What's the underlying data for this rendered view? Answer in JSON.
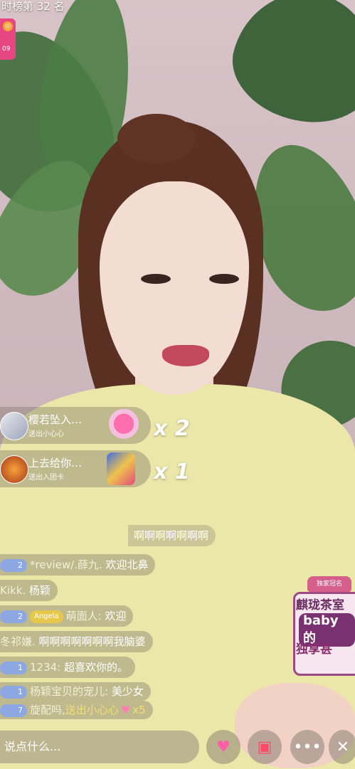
{
  "header": {
    "rank_text": "时榜第 32 名",
    "level_badge_number": "09"
  },
  "gift_banners": [
    {
      "name": "樱若坠入…",
      "sub": "送出小心心",
      "count": "x 2",
      "gift_icon": "heart-gift-icon"
    },
    {
      "name": "上去给你…",
      "sub": "送出入团卡",
      "count": "x 1",
      "gift_icon": "fan-card-gift-icon"
    }
  ],
  "overlay_text": "啊啊啊啊啊啊啊",
  "chat": [
    {
      "level": "2",
      "name": "*review/.薛九. ",
      "content": "欢迎北鼻"
    },
    {
      "level": "",
      "name": "Kikk.",
      "content": " 杨颖"
    },
    {
      "level": "2",
      "tag": "Angela",
      "name": "萌面人:",
      "content": " 欢迎"
    },
    {
      "level": "",
      "name": "冬祁嫌.",
      "content": " 啊啊啊啊啊啊啊我脑婆"
    },
    {
      "level": "1",
      "name": "1234:",
      "content": " 超喜欢你的。"
    },
    {
      "level": "1",
      "name": "杨颖宝贝的宠儿:",
      "content": " 美少女"
    },
    {
      "level": "7",
      "name": "旋配吗,",
      "content": "送出小心心",
      "extra": "x5"
    }
  ],
  "promo": {
    "crown": "独家冠名",
    "line1": "麒珑茶室",
    "line2": "baby的",
    "line3": "独享甚"
  },
  "bottom_bar": {
    "input_placeholder": "说点什么...",
    "buttons": [
      "heart-icon",
      "gift-icon",
      "more-icon",
      "close-icon"
    ]
  },
  "colors": {
    "level_badge": "#e64781",
    "gift_count": "#ffffff",
    "chat_bg": "rgba(110,100,95,0.35)"
  }
}
